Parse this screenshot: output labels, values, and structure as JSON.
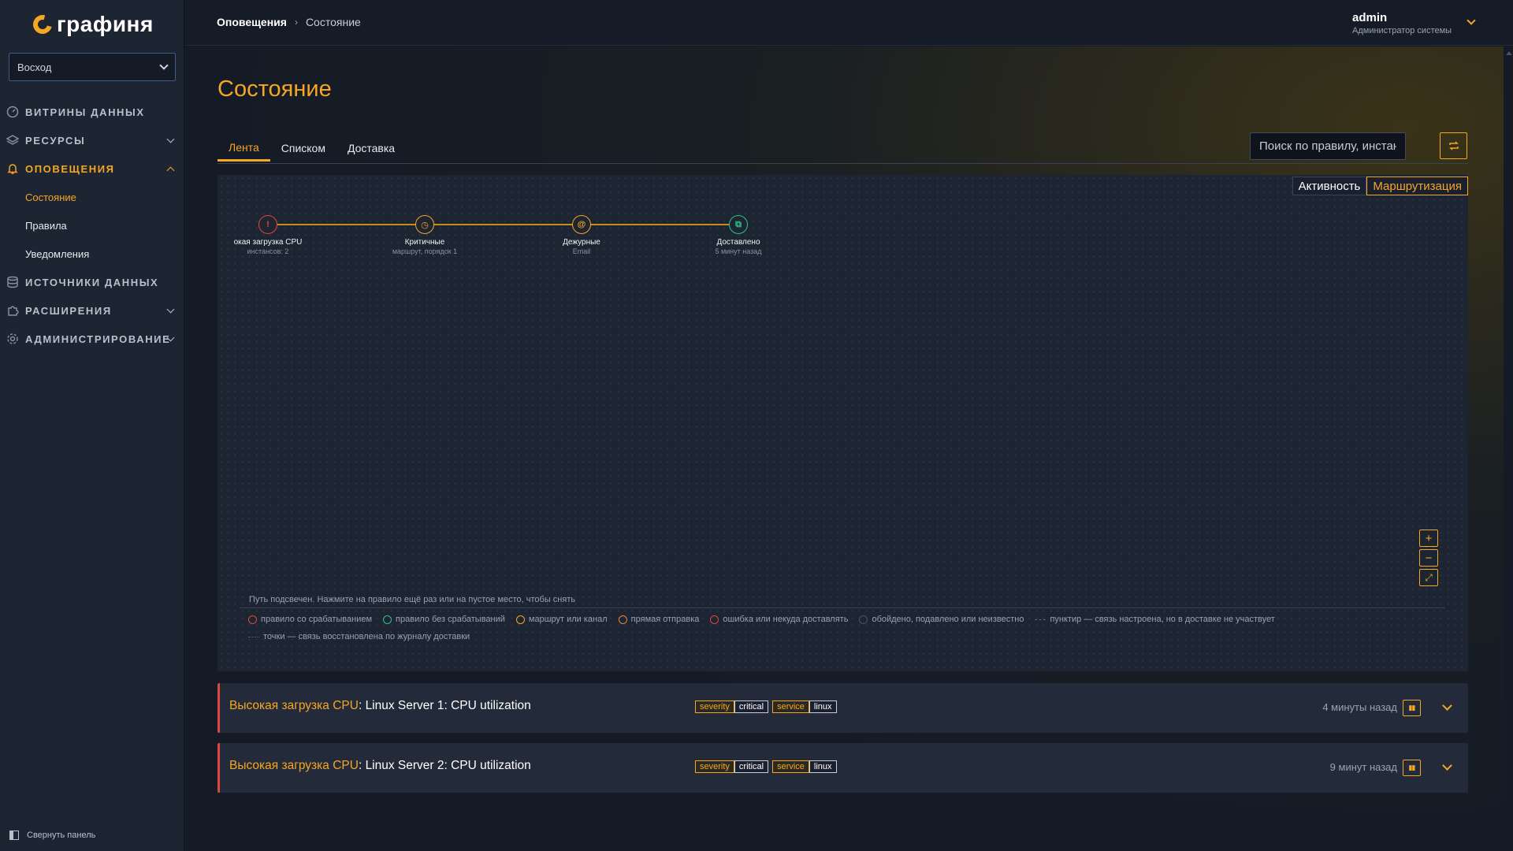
{
  "app": {
    "logo_text": "графиня",
    "colors": {
      "accent": "#f5a623",
      "error": "#e0463a",
      "success": "#2ec28a"
    }
  },
  "org_selector": {
    "value": "Восход"
  },
  "sidebar": {
    "items": [
      {
        "label": "ВИТРИНЫ ДАННЫХ",
        "icon": "dashboard-icon"
      },
      {
        "label": "РЕСУРСЫ",
        "icon": "layers-icon"
      },
      {
        "label": "ОПОВЕЩЕНИЯ",
        "icon": "bell-icon"
      },
      {
        "label": "ИСТОЧНИКИ ДАННЫХ",
        "icon": "database-icon"
      },
      {
        "label": "РАСШИРЕНИЯ",
        "icon": "puzzle-icon"
      },
      {
        "label": "АДМИНИСТРИРОВАНИЕ",
        "icon": "gear-icon"
      }
    ],
    "subitems": [
      {
        "label": "Состояние"
      },
      {
        "label": "Правила"
      },
      {
        "label": "Уведомления"
      }
    ],
    "collapse_label": "Свернуть панель"
  },
  "header": {
    "breadcrumb_root": "Оповещения",
    "breadcrumb_sep": "›",
    "breadcrumb_current": "Состояние",
    "user_name": "admin",
    "user_role": "Администратор системы"
  },
  "page": {
    "title": "Состояние",
    "tabs": [
      {
        "label": "Лента"
      },
      {
        "label": "Списком"
      },
      {
        "label": "Доставка"
      }
    ],
    "search_placeholder": "Поиск по правилу, инстанс"
  },
  "graph": {
    "modes": [
      "Активность",
      "Маршрутизация"
    ],
    "nodes": [
      {
        "glyph": "!",
        "label": "окая загрузка CPU",
        "sub": "инстансов: 2",
        "color": "#e0463a"
      },
      {
        "glyph": "◷",
        "label": "Критичные",
        "sub": "маршрут, порядок 1",
        "color": "#f5a623"
      },
      {
        "glyph": "@",
        "label": "Дежурные",
        "sub": "Email",
        "color": "#f5a623"
      },
      {
        "glyph": "⧉",
        "label": "Доставлено",
        "sub": "5 минут назад",
        "color": "#2ec28a"
      }
    ],
    "zoom": {
      "in": "+",
      "out": "−",
      "fit": "⤢"
    },
    "hint": "Путь подсвечен. Нажмите на правило ещё раз или на пустое место, чтобы снять",
    "legend": [
      {
        "label": "правило со срабатыванием",
        "color": "#e0463a",
        "kind": "dot"
      },
      {
        "label": "правило без срабатываний",
        "color": "#2ec28a",
        "kind": "dot"
      },
      {
        "label": "маршрут или канал",
        "color": "#f5a623",
        "kind": "dot"
      },
      {
        "label": "прямая отправка",
        "color": "#e8853a",
        "kind": "dot"
      },
      {
        "label": "ошибка или некуда доставлять",
        "color": "#e0463a",
        "kind": "dot"
      },
      {
        "label": "обойдено, подавлено или неизвестно",
        "color": "#4a5262",
        "kind": "dot"
      },
      {
        "label": "пунктир — связь настроена, но в доставке не участвует",
        "kind": "dash"
      },
      {
        "label": "точки — связь восстановлена по журналу доставки",
        "kind": "dots"
      }
    ]
  },
  "alerts": [
    {
      "rule": "Высокая загрузка CPU",
      "sep": ": ",
      "instance": "Linux Server 1: CPU utilization",
      "labels": [
        {
          "k": "severity",
          "v": "critical"
        },
        {
          "k": "service",
          "v": "linux"
        }
      ],
      "time": "4 минуты назад"
    },
    {
      "rule": "Высокая загрузка CPU",
      "sep": ": ",
      "instance": "Linux Server 2: CPU utilization",
      "labels": [
        {
          "k": "severity",
          "v": "critical"
        },
        {
          "k": "service",
          "v": "linux"
        }
      ],
      "time": "9 минут назад"
    }
  ]
}
